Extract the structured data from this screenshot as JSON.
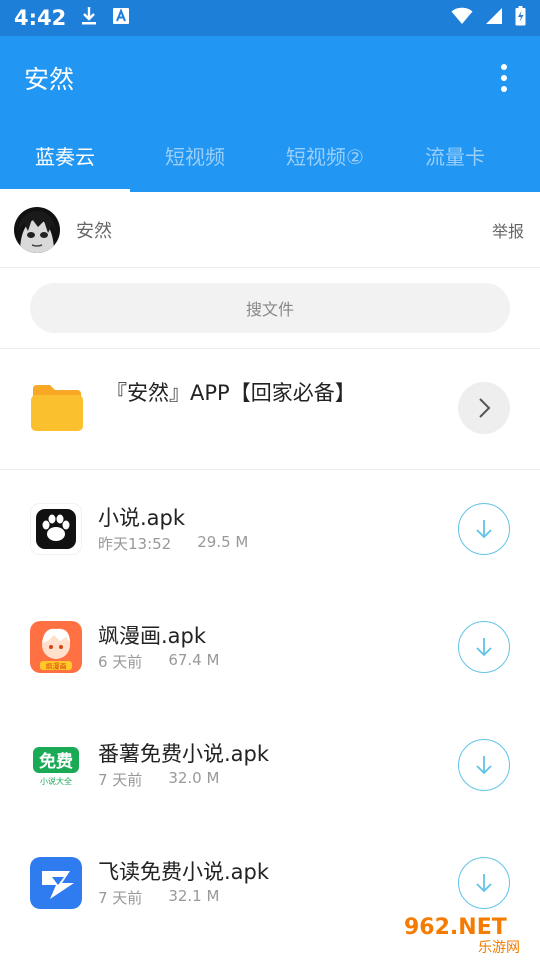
{
  "status_bar": {
    "time": "4:42",
    "icons": [
      "download-icon",
      "a-icon",
      "wifi-icon",
      "signal-icon",
      "battery-icon"
    ]
  },
  "app_bar": {
    "title": "安然",
    "menu_icon": "more-vert-icon"
  },
  "tabs": [
    {
      "label": "蓝奏云",
      "active": true
    },
    {
      "label": "短视频",
      "active": false
    },
    {
      "label": "短视频②",
      "active": false
    },
    {
      "label": "流量卡",
      "active": false
    }
  ],
  "user": {
    "name": "安然",
    "report_label": "举报"
  },
  "search": {
    "placeholder": "搜文件"
  },
  "folder": {
    "name": "『安然』APP【回家必备】"
  },
  "files": [
    {
      "name": "小说.apk",
      "date": "昨天13:52",
      "size": "29.5 M",
      "icon": "paw-app-icon"
    },
    {
      "name": "飒漫画.apk",
      "date": "6 天前",
      "size": "67.4 M",
      "icon": "manga-app-icon"
    },
    {
      "name": "番薯免费小说.apk",
      "date": "7 天前",
      "size": "32.0 M",
      "icon": "free-novel-app-icon"
    },
    {
      "name": "飞读免费小说.apk",
      "date": "7 天前",
      "size": "32.1 M",
      "icon": "feidu-app-icon"
    }
  ],
  "colors": {
    "primary": "#2196f3",
    "status_bar": "#1e7fd9",
    "download_ring": "#62c3e8",
    "folder": "#fbc02d"
  },
  "watermark": {
    "text_top": "962.NET",
    "text_bottom": "乐游网"
  },
  "file_icon_labels": {
    "manga": "飒漫画",
    "free_novel_big": "免费",
    "free_novel_small": "小说大全"
  }
}
